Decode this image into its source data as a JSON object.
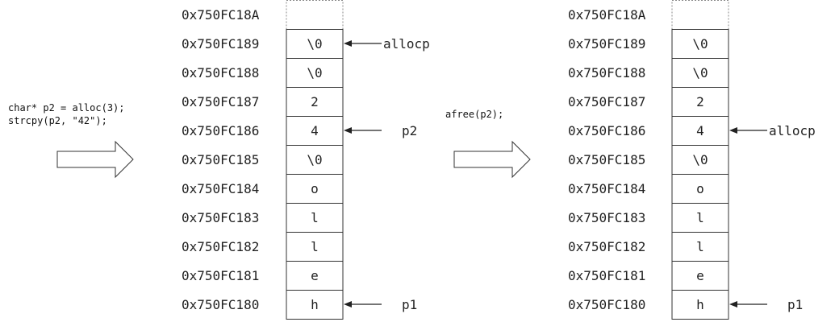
{
  "addresses": [
    "0x750FC18A",
    "0x750FC189",
    "0x750FC188",
    "0x750FC187",
    "0x750FC186",
    "0x750FC185",
    "0x750FC184",
    "0x750FC183",
    "0x750FC182",
    "0x750FC181",
    "0x750FC180"
  ],
  "diagrams": [
    {
      "cells": [
        "",
        "\\0",
        "\\0",
        "2",
        "4",
        "\\0",
        "o",
        "l",
        "l",
        "e",
        "h"
      ],
      "pointers": [
        {
          "label": "allocp",
          "row": 1
        },
        {
          "label": "p2",
          "row": 4
        },
        {
          "label": "p1",
          "row": 10
        }
      ]
    },
    {
      "cells": [
        "",
        "\\0",
        "\\0",
        "2",
        "4",
        "\\0",
        "o",
        "l",
        "l",
        "e",
        "h"
      ],
      "pointers": [
        {
          "label": "allocp",
          "row": 4
        },
        {
          "label": "p1",
          "row": 10
        }
      ]
    }
  ],
  "transitions": [
    {
      "code": [
        "char* p2 = alloc(3);",
        "strcpy(p2, \"42\");"
      ]
    },
    {
      "code": [
        "afree(p2);"
      ]
    }
  ]
}
